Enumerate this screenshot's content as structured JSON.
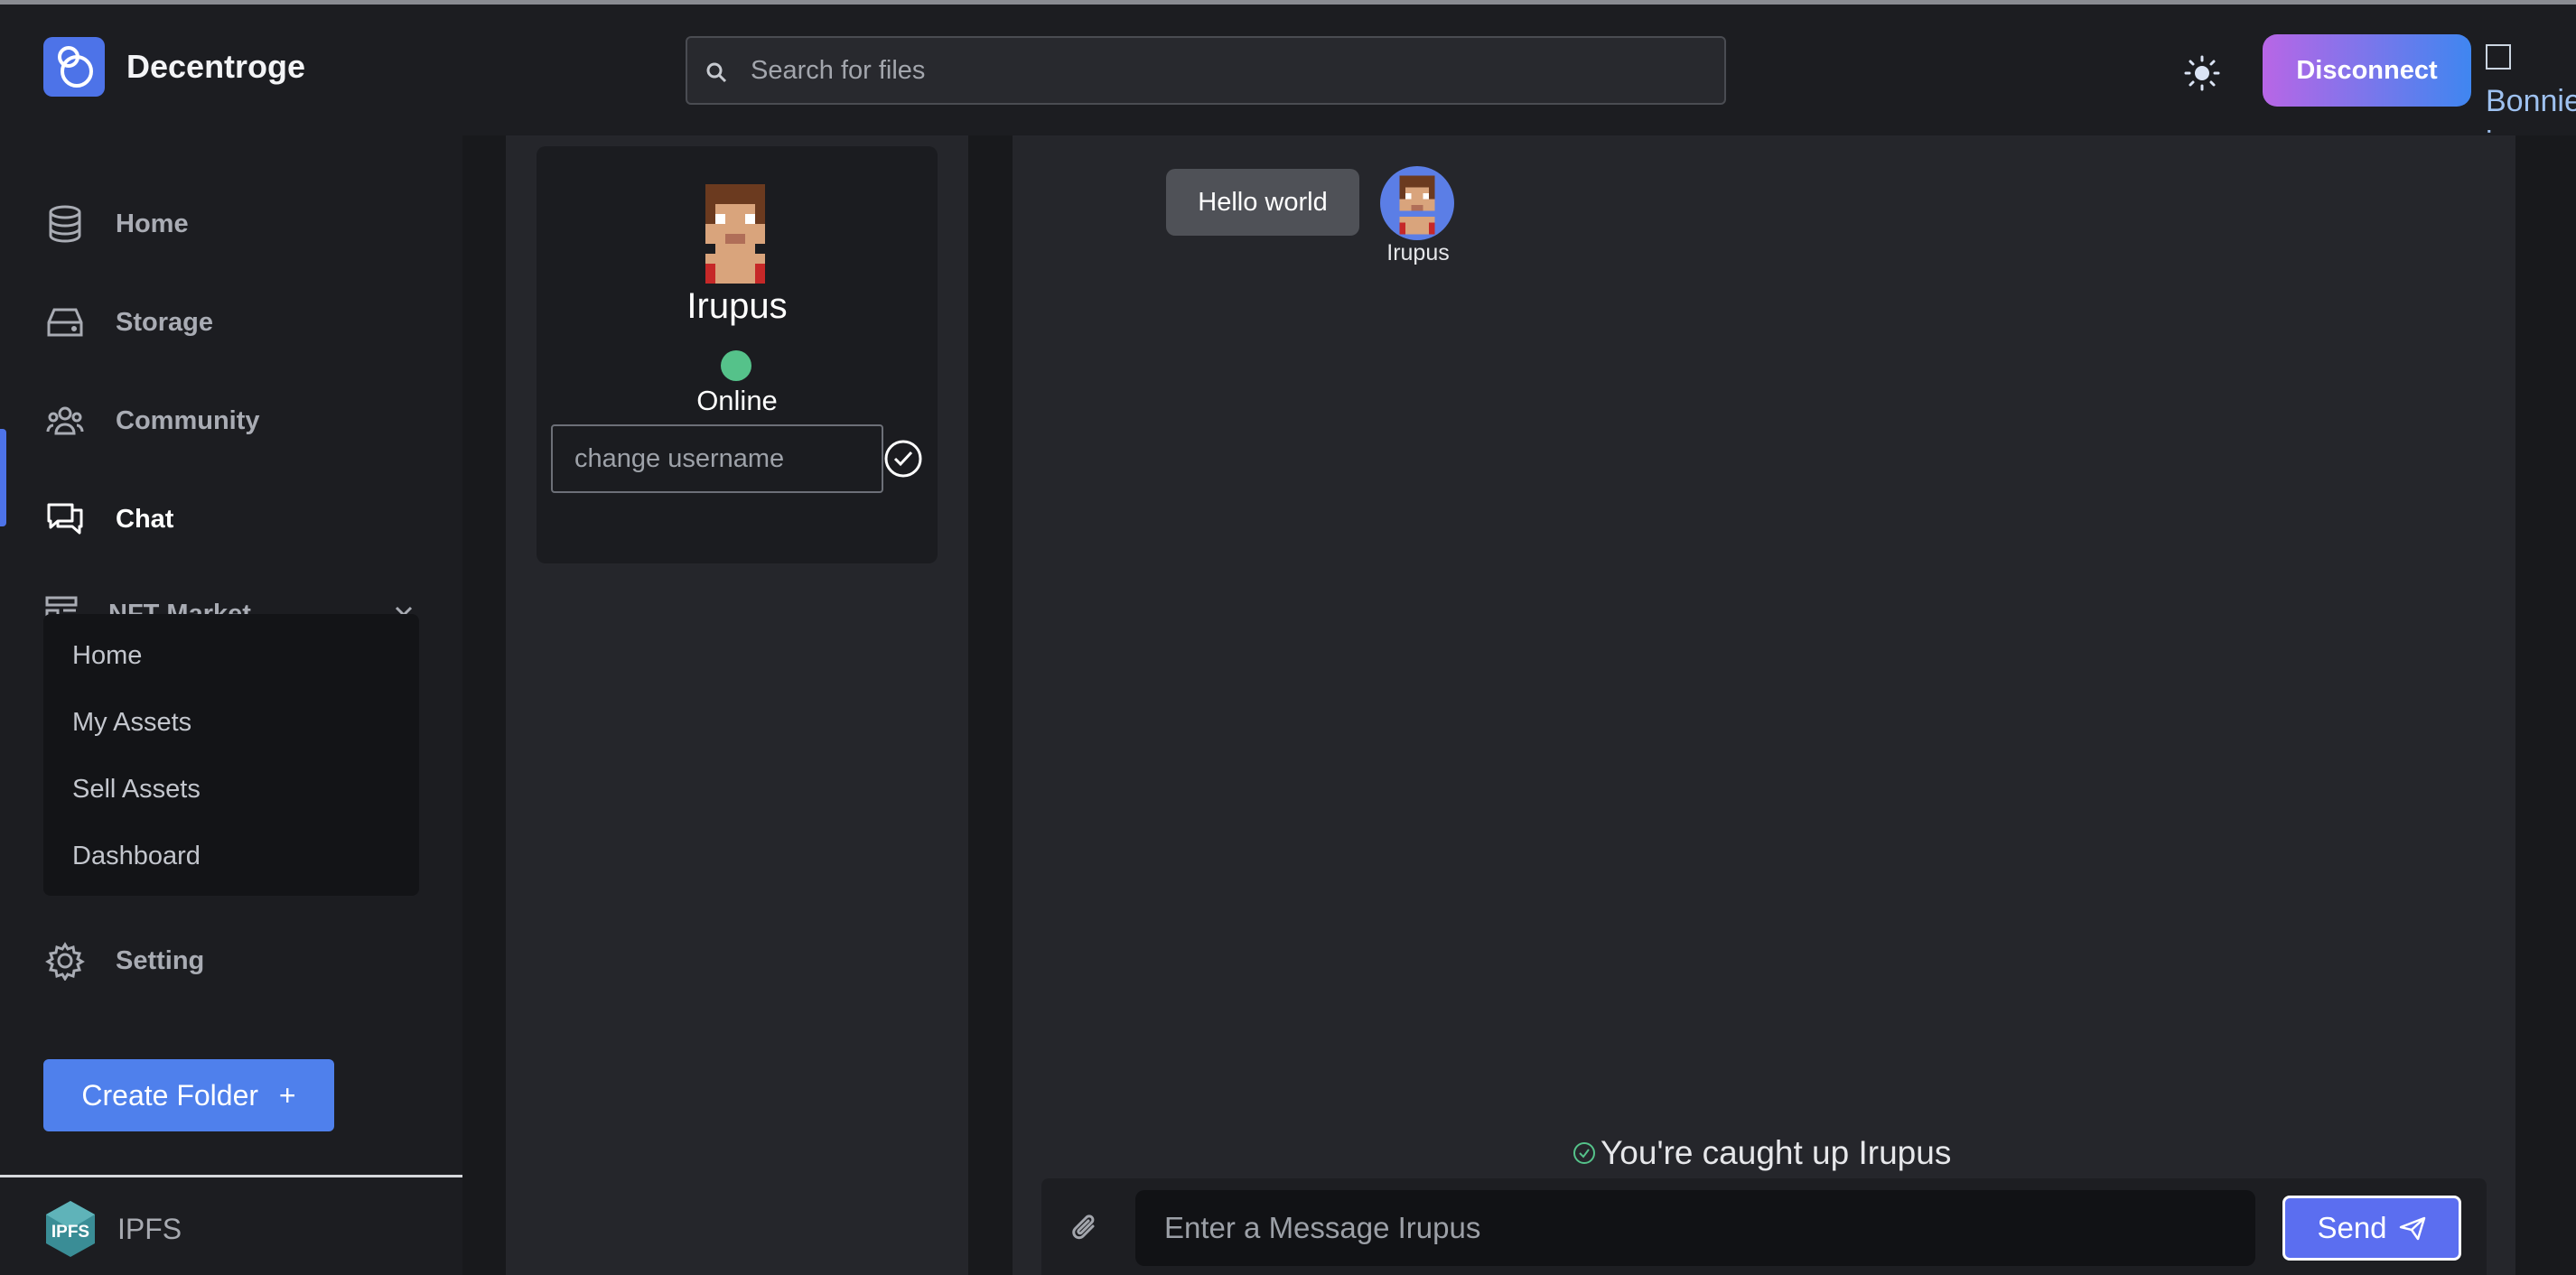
{
  "app": {
    "name": "Decentroge",
    "accent": "#4d73e8"
  },
  "header": {
    "search_placeholder": "Search for files",
    "disconnect_label": "Disconnect",
    "broken_avatar_alt": "Bonnie image"
  },
  "sidebar": {
    "items": [
      {
        "label": "Home",
        "icon": "database-icon"
      },
      {
        "label": "Storage",
        "icon": "hard-drive-icon"
      },
      {
        "label": "Community",
        "icon": "users-icon"
      },
      {
        "label": "Chat",
        "icon": "chat-bubbles-icon",
        "active": true
      },
      {
        "label": "NFT Market",
        "icon": "market-icon",
        "expanded": true
      },
      {
        "label": "Setting",
        "icon": "gear-icon"
      }
    ],
    "nft_submenu": [
      "Home",
      "My Assets",
      "Sell Assets",
      "Dashboard"
    ],
    "create_folder_label": "Create Folder",
    "create_folder_plus": "+",
    "ipfs_label": "IPFS",
    "ipfs_logo_text": "IPFS"
  },
  "profile": {
    "name": "Irupus",
    "status": "Online",
    "status_color": "#55c28a",
    "username_placeholder": "change username"
  },
  "chat": {
    "messages": [
      {
        "text": "Hello world",
        "author": "Irupus"
      }
    ],
    "caught_up_text": "You're caught up Irupus",
    "input_placeholder": "Enter a Message Irupus",
    "send_label": "Send"
  }
}
